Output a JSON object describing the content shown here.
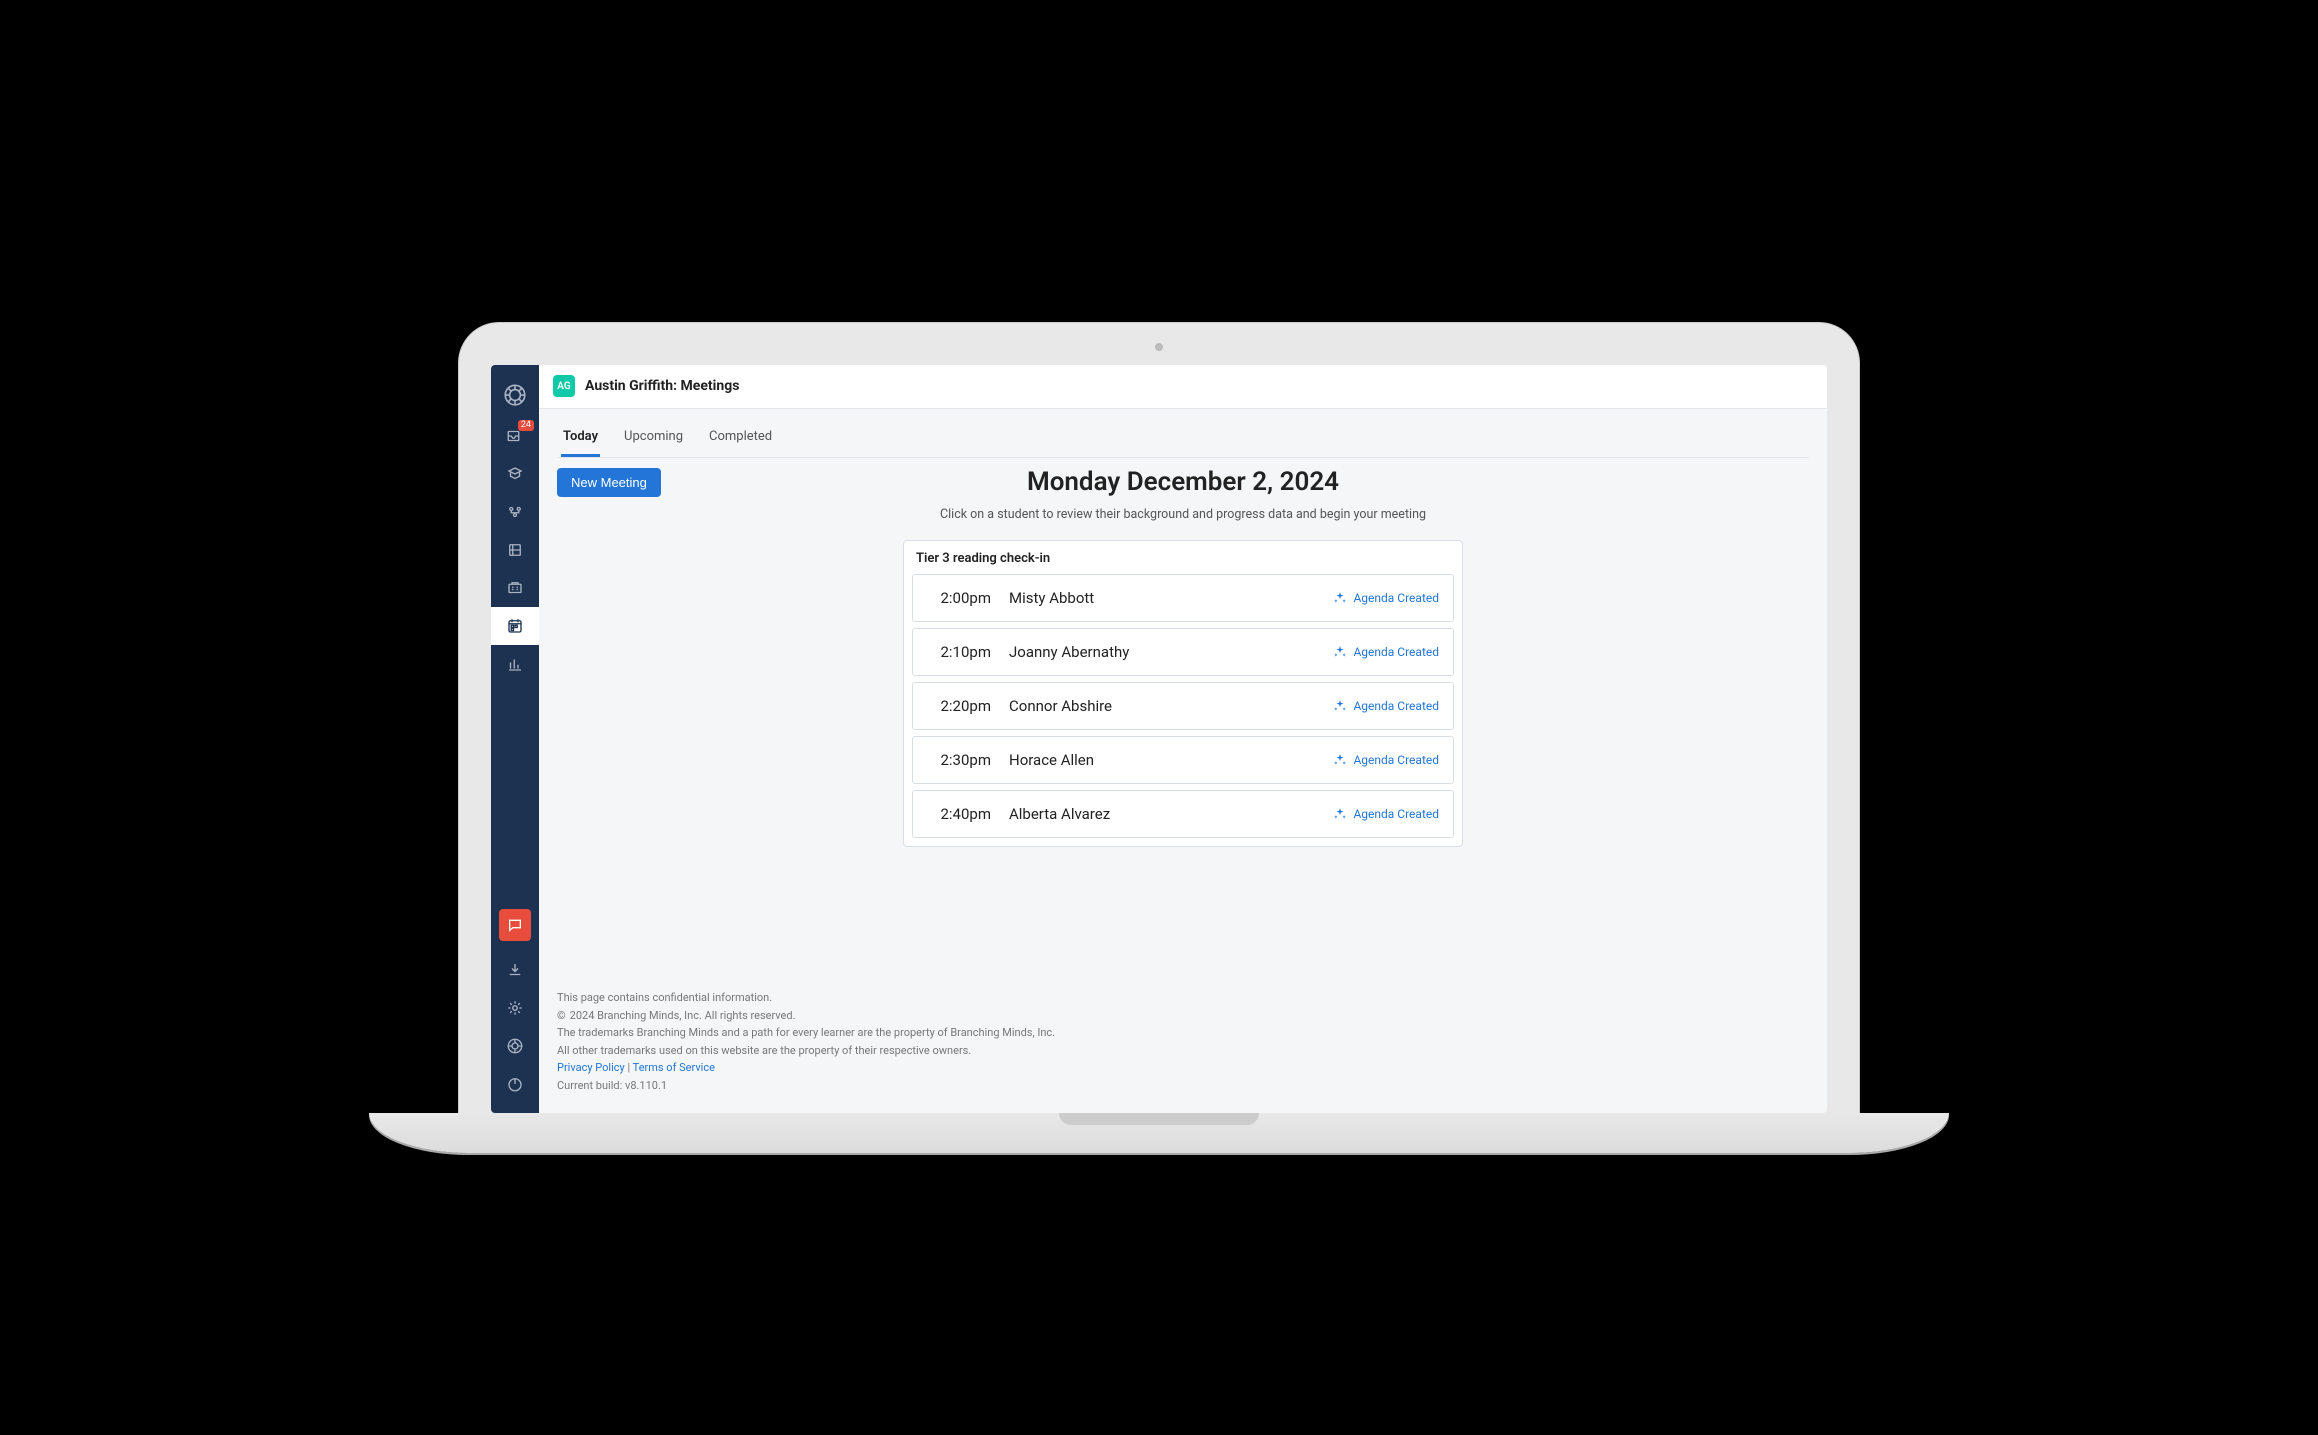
{
  "header": {
    "initials": "AG",
    "title": "Austin Griffith: Meetings"
  },
  "tabs": [
    {
      "label": "Today",
      "active": true
    },
    {
      "label": "Upcoming",
      "active": false
    },
    {
      "label": "Completed",
      "active": false
    }
  ],
  "new_meeting_label": "New Meeting",
  "page": {
    "date_heading": "Monday December 2, 2024",
    "subtitle": "Click on a student to review their background and progress data and begin your meeting"
  },
  "meeting_group": {
    "title": "Tier 3 reading check-in",
    "items": [
      {
        "time": "2:00pm",
        "name": "Misty Abbott",
        "status": "Agenda Created"
      },
      {
        "time": "2:10pm",
        "name": "Joanny Abernathy",
        "status": "Agenda Created"
      },
      {
        "time": "2:20pm",
        "name": "Connor Abshire",
        "status": "Agenda Created"
      },
      {
        "time": "2:30pm",
        "name": "Horace Allen",
        "status": "Agenda Created"
      },
      {
        "time": "2:40pm",
        "name": "Alberta Alvarez",
        "status": "Agenda Created"
      }
    ]
  },
  "sidebar": {
    "badge_count": "24"
  },
  "footer": {
    "line1": "This page contains confidential information.",
    "copyright": "2024 Branching Minds, Inc. All rights reserved.",
    "line3": "The trademarks Branching Minds and a path for every learner are the property of Branching Minds, Inc.",
    "line4": "All other trademarks used on this website are the property of their respective owners.",
    "privacy": "Privacy Policy",
    "terms": "Terms of Service",
    "build": "Current build: v8.110.1"
  }
}
